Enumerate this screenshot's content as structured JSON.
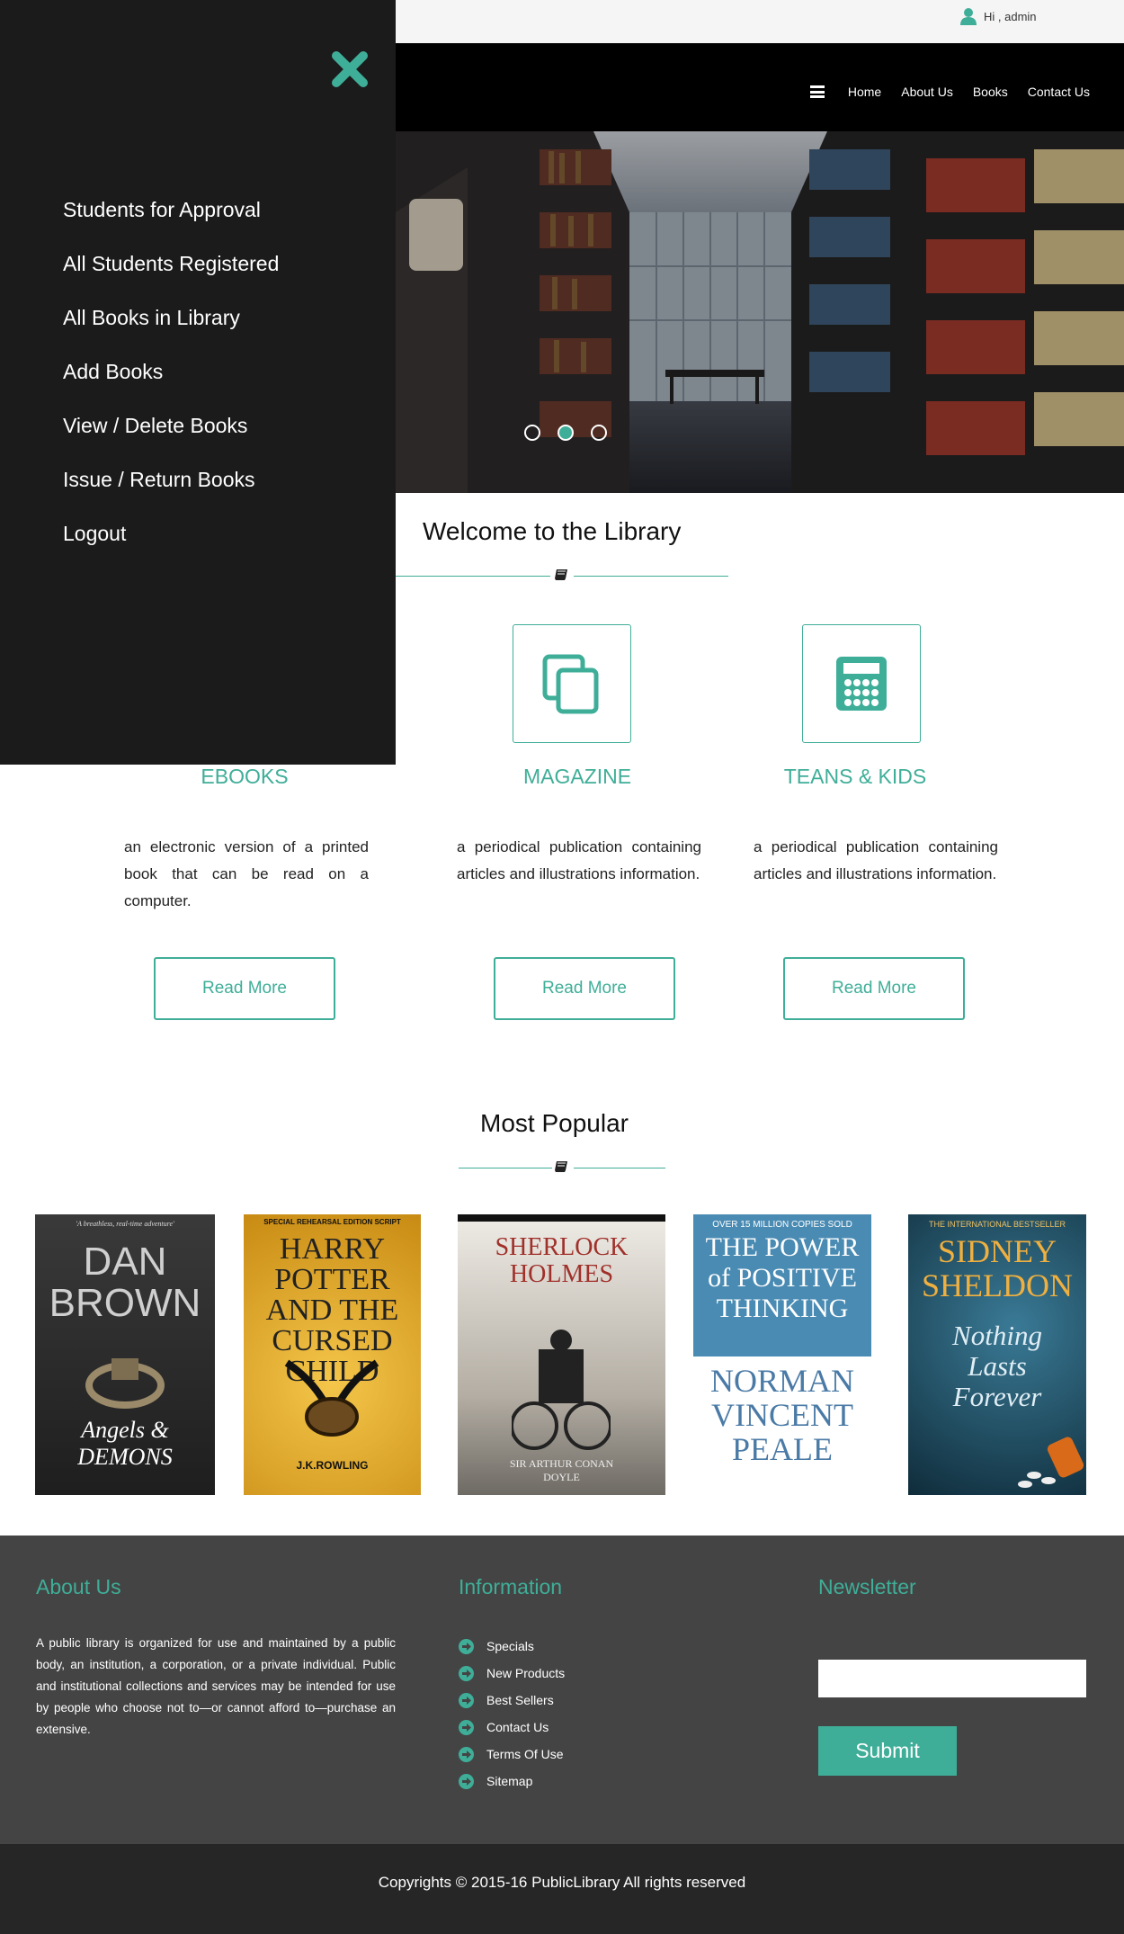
{
  "topbar": {
    "greeting": "Hi , admin"
  },
  "nav": {
    "links": [
      "Home",
      "About Us",
      "Books",
      "Contact Us"
    ]
  },
  "hero": {
    "slides": 3,
    "active_slide": 2
  },
  "sidebar": {
    "items": [
      "Students for Approval",
      "All Students Registered",
      "All Books in Library",
      "Add Books",
      "View / Delete Books",
      "Issue / Return Books",
      "Logout"
    ]
  },
  "welcome": {
    "title": "Welcome to the Library"
  },
  "features": [
    {
      "title": "EBOOKS",
      "text": "an electronic version of a printed book that can be read on a computer.",
      "button": "Read More",
      "icon": "ebook-icon"
    },
    {
      "title": "MAGAZINE",
      "text": "a periodical publication containing articles and illustrations information.",
      "button": "Read More",
      "icon": "copy-icon"
    },
    {
      "title": "TEANS & KIDS",
      "text": "a periodical publication containing articles and illustrations information.",
      "button": "Read More",
      "icon": "calculator-icon"
    }
  ],
  "popular": {
    "title": "Most Popular",
    "books": [
      {
        "top": "'A breathless, real-time adventure'",
        "author": "DAN BROWN",
        "title": "Angels & DEMONS"
      },
      {
        "top": "SPECIAL REHEARSAL EDITION SCRIPT",
        "author": "J.K.ROWLING",
        "title": "HARRY POTTER AND THE CURSED CHILD"
      },
      {
        "top": "",
        "author": "SIR ARTHUR CONAN DOYLE",
        "title": "SHERLOCK HOLMES"
      },
      {
        "top": "OVER 15 MILLION COPIES SOLD",
        "author": "NORMAN VINCENT PEALE",
        "title": "THE POWER of POSITIVE THINKING"
      },
      {
        "top": "THE INTERNATIONAL BESTSELLER",
        "author": "SIDNEY SHELDON",
        "title": "Nothing Lasts Forever"
      }
    ]
  },
  "footer": {
    "about_title": "About Us",
    "about_text": "A public library is organized for use and maintained by a public body, an institution, a corporation, or a private individual. Public and institutional collections and services may be intended for use by people who choose not to—or cannot afford to—purchase an extensive.",
    "info_title": "Information",
    "info_links": [
      "Specials",
      "New Products",
      "Best Sellers",
      "Contact Us",
      "Terms Of Use",
      "Sitemap"
    ],
    "newsletter_title": "Newsletter",
    "newsletter_placeholder": "",
    "submit_label": "Submit"
  },
  "copyright": "Copyrights © 2015-16 PublicLibrary All rights reserved",
  "colors": {
    "accent": "#3fae98",
    "sidebar": "#1b1b1b",
    "footer": "#444444",
    "bottombar": "#262626"
  }
}
